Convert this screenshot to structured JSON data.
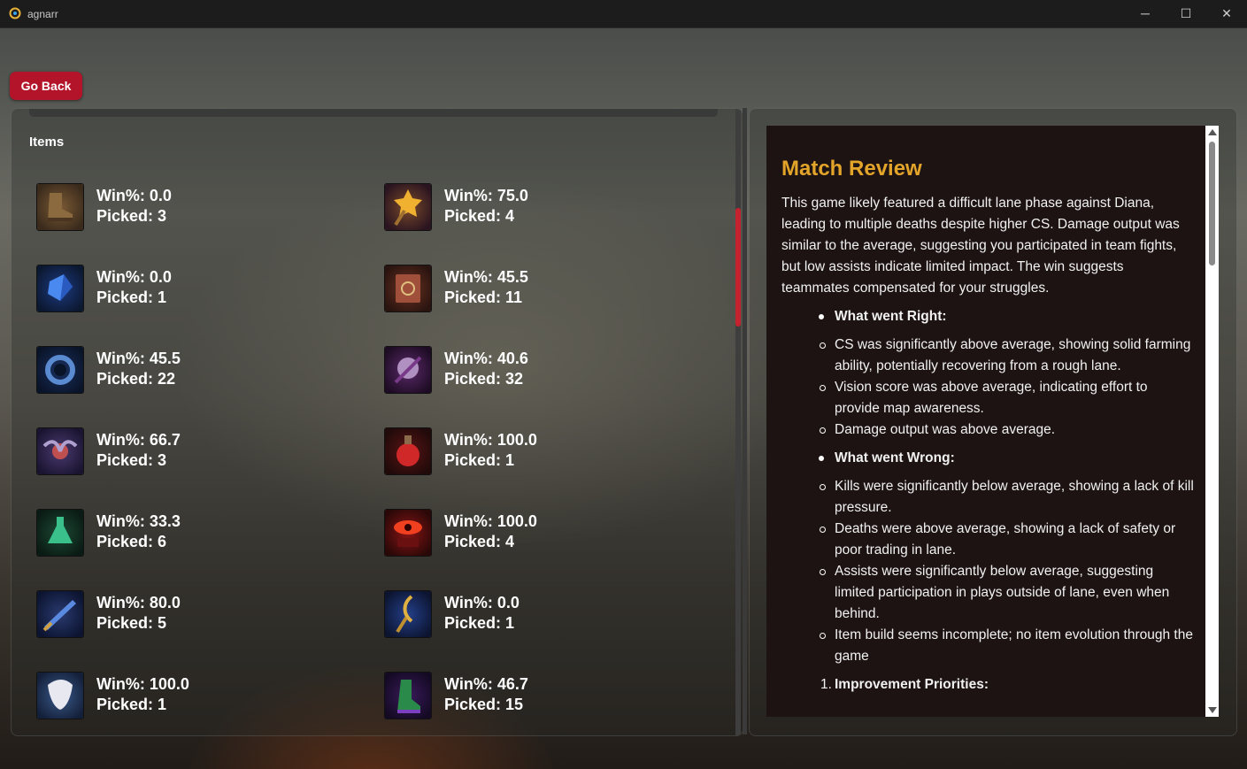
{
  "window": {
    "title": "agnarr",
    "minimize_glyph": "─",
    "maximize_glyph": "☐",
    "close_glyph": "✕"
  },
  "go_back_label": "Go Back",
  "items_panel": {
    "heading": "Items",
    "items": [
      {
        "icon": "boots-icon",
        "win": "Win%: 0.0",
        "picked": "Picked: 3"
      },
      {
        "icon": "star-wand-icon",
        "win": "Win%: 75.0",
        "picked": "Picked: 4"
      },
      {
        "icon": "blue-crystal-icon",
        "win": "Win%: 0.0",
        "picked": "Picked: 1"
      },
      {
        "icon": "tome-icon",
        "win": "Win%: 45.5",
        "picked": "Picked: 11"
      },
      {
        "icon": "sapphire-ring-icon",
        "win": "Win%: 45.5",
        "picked": "Picked: 22"
      },
      {
        "icon": "violet-emblem-icon",
        "win": "Win%: 40.6",
        "picked": "Picked: 32"
      },
      {
        "icon": "winged-orb-icon",
        "win": "Win%: 66.7",
        "picked": "Picked: 3"
      },
      {
        "icon": "red-potion-icon",
        "win": "Win%: 100.0",
        "picked": "Picked: 1"
      },
      {
        "icon": "green-flask-icon",
        "win": "Win%: 33.3",
        "picked": "Picked: 6"
      },
      {
        "icon": "red-eye-icon",
        "win": "Win%: 100.0",
        "picked": "Picked: 4"
      },
      {
        "icon": "arcane-blade-icon",
        "win": "Win%: 80.0",
        "picked": "Picked: 5"
      },
      {
        "icon": "golden-staff-icon",
        "win": "Win%: 0.0",
        "picked": "Picked: 1"
      },
      {
        "icon": "white-mask-icon",
        "win": "Win%: 100.0",
        "picked": "Picked: 1"
      },
      {
        "icon": "green-greaves-icon",
        "win": "Win%: 46.7",
        "picked": "Picked: 15"
      }
    ]
  },
  "review": {
    "title": "Match Review",
    "summary": "This game likely featured a difficult lane phase against Diana, leading to multiple deaths despite higher CS. Damage output was similar to the average, suggesting you participated in team fights, but low assists indicate limited impact. The win suggests teammates compensated for your struggles.",
    "right_title": "What went Right:",
    "right_points": [
      "CS was significantly above average, showing solid farming ability, potentially recovering from a rough lane.",
      "Vision score was above average, indicating effort to provide map awareness.",
      "Damage output was above average."
    ],
    "wrong_title": "What went Wrong:",
    "wrong_points": [
      "Kills were significantly below average, showing a lack of kill pressure.",
      "Deaths were above average, showing a lack of safety or poor trading in lane.",
      "Assists were significantly below average, suggesting limited participation in plays outside of lane, even when behind.",
      "Item build seems incomplete; no item evolution through the game"
    ],
    "priorities_number": "1.",
    "priorities_title": "Improvement Priorities:"
  },
  "colors": {
    "accent_red": "#b3142a",
    "review_title_gold": "#e3a42a",
    "review_bg": "#1d1313"
  }
}
